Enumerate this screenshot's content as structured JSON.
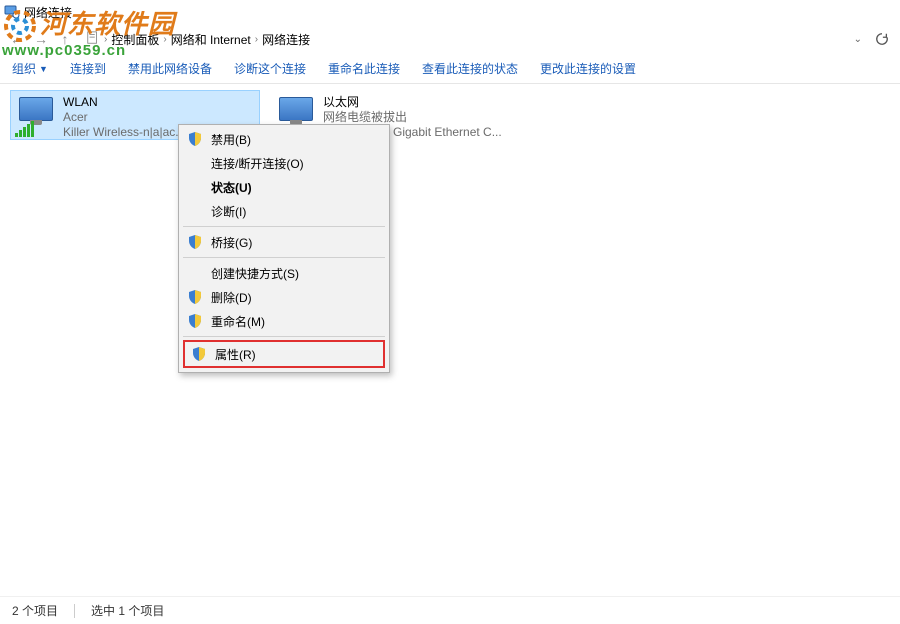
{
  "window": {
    "title": "网络连接"
  },
  "breadcrumb": {
    "root_icon": "doc-icon",
    "parts": [
      "控制面板",
      "网络和 Internet",
      "网络连接"
    ]
  },
  "commands": {
    "organize": "组织",
    "connect": "连接到",
    "disable": "禁用此网络设备",
    "diagnose": "诊断这个连接",
    "rename": "重命名此连接",
    "viewstatus": "查看此连接的状态",
    "change": "更改此连接的设置"
  },
  "items": [
    {
      "name": "WLAN",
      "sub1": "Acer",
      "sub2": "Killer Wireless-n|a|ac...",
      "selected": true,
      "icon": "wifi"
    },
    {
      "name": "以太网",
      "sub1": "网络电缆被拔出",
      "sub2": "Gigabit Ethernet C...",
      "selected": false,
      "icon": "ether"
    }
  ],
  "context_menu": {
    "disable": "禁用(B)",
    "connect": "连接/断开连接(O)",
    "status": "状态(U)",
    "diagnose": "诊断(I)",
    "bridge": "桥接(G)",
    "shortcut": "创建快捷方式(S)",
    "delete": "删除(D)",
    "rename": "重命名(M)",
    "properties": "属性(R)"
  },
  "statusbar": {
    "count": "2 个项目",
    "selected": "选中 1 个项目"
  },
  "watermark": {
    "text": "河东软件园",
    "url": "www.pc0359.cn"
  }
}
